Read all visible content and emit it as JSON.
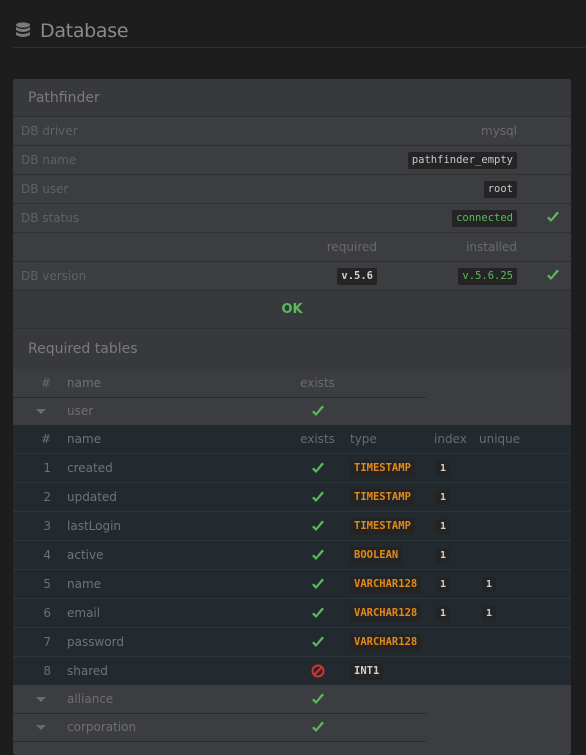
{
  "page": {
    "title": "Database",
    "title_icon": "database-icon"
  },
  "panel": {
    "title": "Pathfinder",
    "info": [
      {
        "label": "DB driver",
        "value": "mysql",
        "style": "plain"
      },
      {
        "label": "DB name",
        "value": "pathfinder_empty",
        "style": "code"
      },
      {
        "label": "DB user",
        "value": "root",
        "style": "code"
      },
      {
        "label": "DB status",
        "value": "connected",
        "style": "code-green",
        "check": true
      }
    ],
    "version_header": {
      "required": "required",
      "installed": "installed"
    },
    "version": {
      "label": "DB version",
      "required": "v.5.6",
      "installed": "v.5.6.25",
      "check": true
    },
    "status_text": "OK"
  },
  "tables_section": {
    "title": "Required tables",
    "outer_headers": {
      "num": "#",
      "name": "name",
      "exists": "exists"
    },
    "groups": [
      {
        "name": "user",
        "exists": true,
        "expanded": true,
        "columns_headers": {
          "num": "#",
          "name": "name",
          "exists": "exists",
          "type": "type",
          "index": "index",
          "unique": "unique"
        },
        "columns": [
          {
            "num": "1",
            "name": "created",
            "exists": true,
            "type": "TIMESTAMP",
            "index": "1",
            "unique": ""
          },
          {
            "num": "2",
            "name": "updated",
            "exists": true,
            "type": "TIMESTAMP",
            "index": "1",
            "unique": ""
          },
          {
            "num": "3",
            "name": "lastLogin",
            "exists": true,
            "type": "TIMESTAMP",
            "index": "1",
            "unique": ""
          },
          {
            "num": "4",
            "name": "active",
            "exists": true,
            "type": "BOOLEAN",
            "index": "1",
            "unique": ""
          },
          {
            "num": "5",
            "name": "name",
            "exists": true,
            "type": "VARCHAR128",
            "index": "1",
            "unique": "1"
          },
          {
            "num": "6",
            "name": "email",
            "exists": true,
            "type": "VARCHAR128",
            "index": "1",
            "unique": "1"
          },
          {
            "num": "7",
            "name": "password",
            "exists": true,
            "type": "VARCHAR128",
            "index": "",
            "unique": ""
          },
          {
            "num": "8",
            "name": "shared",
            "exists": false,
            "type": "INT1",
            "index": "",
            "unique": ""
          }
        ]
      },
      {
        "name": "alliance",
        "exists": true,
        "expanded": false
      },
      {
        "name": "corporation",
        "exists": true,
        "expanded": false
      }
    ]
  },
  "colors": {
    "success": "#5cb85c",
    "danger": "#d9302c",
    "type_orange": "#e28a19",
    "background": "#1d1d1d",
    "panel": "#3b3d40",
    "inner_table": "#232a2f"
  }
}
